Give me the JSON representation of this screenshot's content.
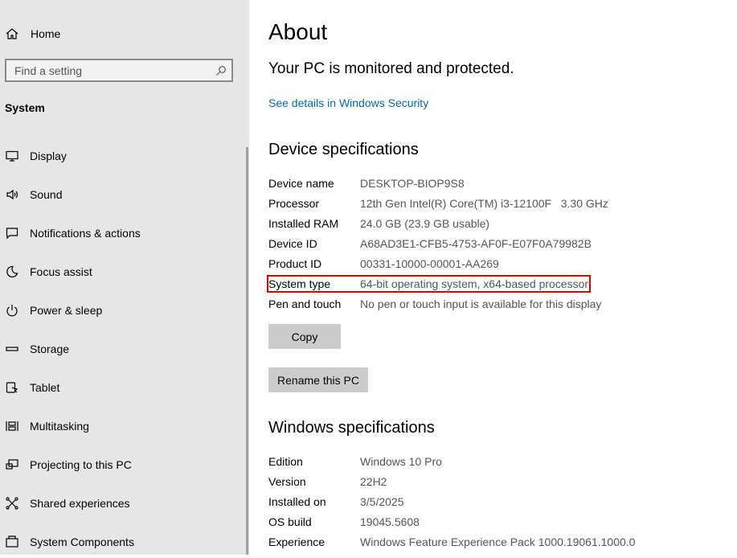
{
  "sidebar": {
    "home_label": "Home",
    "search": {
      "placeholder": "Find a setting",
      "icon": "search-icon"
    },
    "section_heading": "System",
    "items": [
      {
        "label": "Display",
        "icon": "display-icon"
      },
      {
        "label": "Sound",
        "icon": "speaker-icon"
      },
      {
        "label": "Notifications & actions",
        "icon": "notification-icon"
      },
      {
        "label": "Focus assist",
        "icon": "moon-icon"
      },
      {
        "label": "Power & sleep",
        "icon": "power-icon"
      },
      {
        "label": "Storage",
        "icon": "storage-icon"
      },
      {
        "label": "Tablet",
        "icon": "tablet-icon"
      },
      {
        "label": "Multitasking",
        "icon": "multitasking-icon"
      },
      {
        "label": "Projecting to this PC",
        "icon": "projector-icon"
      },
      {
        "label": "Shared experiences",
        "icon": "shared-experiences-icon"
      },
      {
        "label": "System Components",
        "icon": "system-components-icon"
      }
    ]
  },
  "main": {
    "title": "About",
    "status": "Your PC is monitored and protected.",
    "security_link": "See details in Windows Security",
    "device_specs": {
      "heading": "Device specifications",
      "rows": [
        {
          "key": "Device name",
          "value": "DESKTOP-BIOP9S8"
        },
        {
          "key": "Processor",
          "value": "12th Gen Intel(R) Core(TM) i3-12100F   3.30 GHz"
        },
        {
          "key": "Installed RAM",
          "value": "24.0 GB (23.9 GB usable)"
        },
        {
          "key": "Device ID",
          "value": "A68AD3E1-CFB5-4753-AF0F-E07F0A79982B"
        },
        {
          "key": "Product ID",
          "value": "00331-10000-00001-AA269"
        },
        {
          "key": "System type",
          "value": "64-bit operating system, x64-based processor"
        },
        {
          "key": "Pen and touch",
          "value": "No pen or touch input is available for this display"
        }
      ],
      "copy_label": "Copy",
      "rename_label": "Rename this PC"
    },
    "windows_specs": {
      "heading": "Windows specifications",
      "rows": [
        {
          "key": "Edition",
          "value": "Windows 10 Pro"
        },
        {
          "key": "Version",
          "value": "22H2"
        },
        {
          "key": "Installed on",
          "value": "3/5/2025"
        },
        {
          "key": "OS build",
          "value": "19045.5608"
        },
        {
          "key": "Experience",
          "value": "Windows Feature Experience Pack 1000.19061.1000.0"
        }
      ]
    }
  },
  "colors": {
    "highlight": "#e00000",
    "link": "#0067b8",
    "sidebar_bg": "#e6e6e6",
    "button_bg": "#cccccc"
  }
}
